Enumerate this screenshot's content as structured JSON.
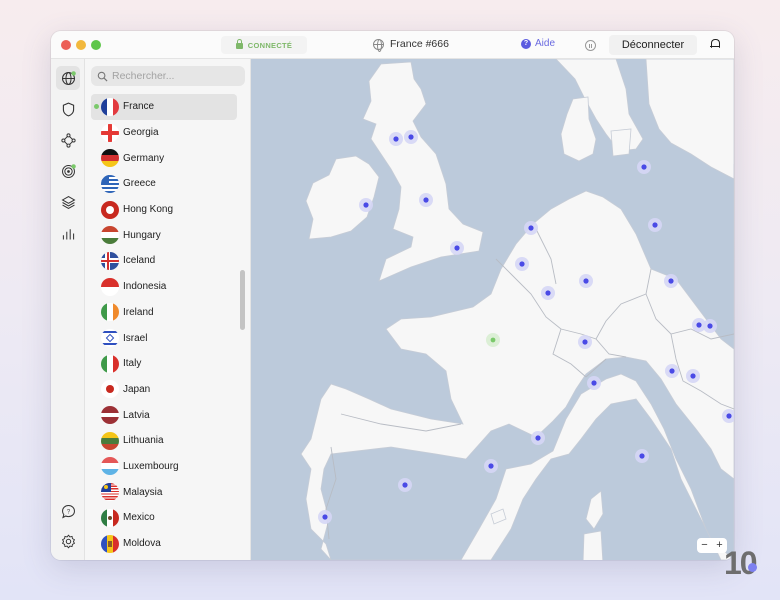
{
  "titlebar": {
    "status": "CONNECTÉ",
    "server": "France #666",
    "help": "Aide",
    "help_glyph": "?",
    "disconnect": "Déconnecter"
  },
  "rail": {
    "items": [
      {
        "name": "globe-icon",
        "active": true,
        "badge": true
      },
      {
        "name": "shield-icon"
      },
      {
        "name": "meshnet-icon"
      },
      {
        "name": "radar-icon",
        "badge": true
      },
      {
        "name": "layers-icon"
      },
      {
        "name": "stats-icon"
      }
    ],
    "bottom": [
      {
        "name": "help-chat-icon"
      },
      {
        "name": "settings-icon"
      }
    ]
  },
  "sidebar": {
    "search_placeholder": "Rechercher...",
    "countries": [
      {
        "name": "France",
        "selected": true,
        "connected": true
      },
      {
        "name": "Georgia"
      },
      {
        "name": "Germany"
      },
      {
        "name": "Greece"
      },
      {
        "name": "Hong Kong"
      },
      {
        "name": "Hungary"
      },
      {
        "name": "Iceland"
      },
      {
        "name": "Indonesia"
      },
      {
        "name": "Ireland"
      },
      {
        "name": "Israel"
      },
      {
        "name": "Italy"
      },
      {
        "name": "Japan"
      },
      {
        "name": "Latvia"
      },
      {
        "name": "Lithuania"
      },
      {
        "name": "Luxembourg"
      },
      {
        "name": "Malaysia"
      },
      {
        "name": "Mexico"
      },
      {
        "name": "Moldova"
      }
    ]
  },
  "map": {
    "zoom_out": "−",
    "zoom_in": "+",
    "colors": {
      "sea": "#bccadb",
      "land": "#f7f7f7",
      "server": "#4a4ae6",
      "server_halo": "#d5d6f5",
      "connected": "#7bc96b",
      "connected_halo": "#dcefd6"
    }
  },
  "watermark": "10",
  "colors": {
    "accent": "#5c5ce0",
    "connected_green": "#7fb86a"
  }
}
